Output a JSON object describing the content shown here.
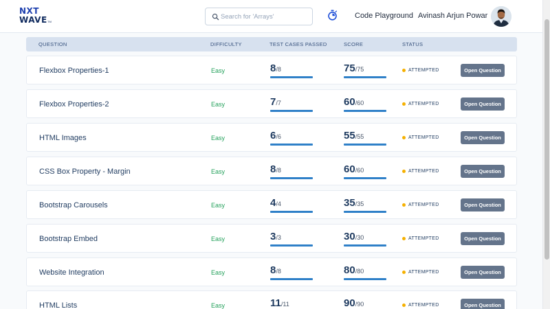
{
  "logo": {
    "line1": "NXT",
    "line2": "WAVE",
    "tm": "TM"
  },
  "search": {
    "placeholder": "Search for 'Arrays'"
  },
  "header": {
    "playground": "Code Playground",
    "username": "Avinash Arjun Powar"
  },
  "table": {
    "columns": [
      "QUESTION",
      "DIFFICULTY",
      "TEST CASES PASSED",
      "SCORE",
      "STATUS"
    ],
    "button_label": "Open Question",
    "rows": [
      {
        "question": "Flexbox Properties-1",
        "difficulty": "Easy",
        "tests_passed": "8",
        "tests_total": "/8",
        "score": "75",
        "score_total": "/75",
        "status": "ATTEMPTED"
      },
      {
        "question": "Flexbox Properties-2",
        "difficulty": "Easy",
        "tests_passed": "7",
        "tests_total": "/7",
        "score": "60",
        "score_total": "/60",
        "status": "ATTEMPTED"
      },
      {
        "question": "HTML Images",
        "difficulty": "Easy",
        "tests_passed": "6",
        "tests_total": "/6",
        "score": "55",
        "score_total": "/55",
        "status": "ATTEMPTED"
      },
      {
        "question": "CSS Box Property - Margin",
        "difficulty": "Easy",
        "tests_passed": "8",
        "tests_total": "/8",
        "score": "60",
        "score_total": "/60",
        "status": "ATTEMPTED"
      },
      {
        "question": "Bootstrap Carousels",
        "difficulty": "Easy",
        "tests_passed": "4",
        "tests_total": "/4",
        "score": "35",
        "score_total": "/35",
        "status": "ATTEMPTED"
      },
      {
        "question": "Bootstrap Embed",
        "difficulty": "Easy",
        "tests_passed": "3",
        "tests_total": "/3",
        "score": "30",
        "score_total": "/30",
        "status": "ATTEMPTED"
      },
      {
        "question": "Website Integration",
        "difficulty": "Easy",
        "tests_passed": "8",
        "tests_total": "/8",
        "score": "80",
        "score_total": "/80",
        "status": "ATTEMPTED"
      },
      {
        "question": "HTML Lists",
        "difficulty": "Easy",
        "tests_passed": "11",
        "tests_total": "/11",
        "score": "90",
        "score_total": "/90",
        "status": "ATTEMPTED"
      }
    ]
  },
  "colors": {
    "accent": "#2f80c8",
    "easy": "#22a05a",
    "attempted": "#f5b000",
    "button": "#64748b",
    "header_row": "#d7e1ef"
  },
  "icons": {
    "search": "search-icon",
    "timer": "stopwatch-icon",
    "avatar": "user-avatar"
  }
}
